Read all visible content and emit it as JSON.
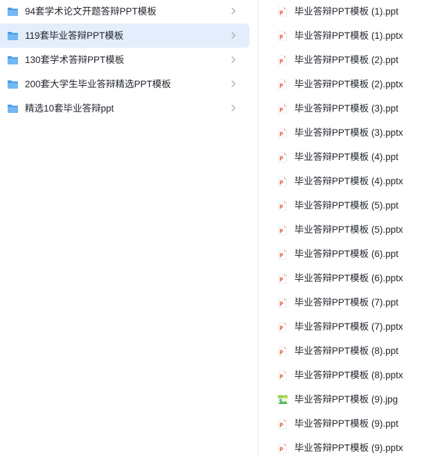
{
  "folders": [
    {
      "label": "94套学术论文开题答辩PPT模板",
      "icon": "folder-icon",
      "selected": false
    },
    {
      "label": "119套毕业答辩PPT模板",
      "icon": "folder-icon",
      "selected": true
    },
    {
      "label": "130套学术答辩PPT模板",
      "icon": "folder-icon",
      "selected": false
    },
    {
      "label": "200套大学生毕业答辩精选PPT模板",
      "icon": "folder-icon",
      "selected": false
    },
    {
      "label": "精选10套毕业答辩ppt",
      "icon": "folder-icon",
      "selected": false
    }
  ],
  "files": [
    {
      "label": "毕业答辩PPT模板 (1).ppt",
      "icon": "ppt-file-icon"
    },
    {
      "label": "毕业答辩PPT模板 (1).pptx",
      "icon": "ppt-file-icon"
    },
    {
      "label": "毕业答辩PPT模板 (2).ppt",
      "icon": "ppt-file-icon"
    },
    {
      "label": "毕业答辩PPT模板 (2).pptx",
      "icon": "ppt-file-icon"
    },
    {
      "label": "毕业答辩PPT模板 (3).ppt",
      "icon": "ppt-file-icon"
    },
    {
      "label": "毕业答辩PPT模板 (3).pptx",
      "icon": "ppt-file-icon"
    },
    {
      "label": "毕业答辩PPT模板 (4).ppt",
      "icon": "ppt-file-icon"
    },
    {
      "label": "毕业答辩PPT模板 (4).pptx",
      "icon": "ppt-file-icon"
    },
    {
      "label": "毕业答辩PPT模板 (5).ppt",
      "icon": "ppt-file-icon"
    },
    {
      "label": "毕业答辩PPT模板 (5).pptx",
      "icon": "ppt-file-icon"
    },
    {
      "label": "毕业答辩PPT模板 (6).ppt",
      "icon": "ppt-file-icon"
    },
    {
      "label": "毕业答辩PPT模板 (6).pptx",
      "icon": "ppt-file-icon"
    },
    {
      "label": "毕业答辩PPT模板 (7).ppt",
      "icon": "ppt-file-icon"
    },
    {
      "label": "毕业答辩PPT模板 (7).pptx",
      "icon": "ppt-file-icon"
    },
    {
      "label": "毕业答辩PPT模板 (8).ppt",
      "icon": "ppt-file-icon"
    },
    {
      "label": "毕业答辩PPT模板 (8).pptx",
      "icon": "ppt-file-icon"
    },
    {
      "label": "毕业答辩PPT模板 (9).jpg",
      "icon": "image-file-icon"
    },
    {
      "label": "毕业答辩PPT模板 (9).ppt",
      "icon": "ppt-file-icon"
    },
    {
      "label": "毕业答辩PPT模板 (9).pptx",
      "icon": "ppt-file-icon"
    }
  ],
  "colors": {
    "selected_background": "#e4edfb",
    "folder_blue": "#5aa9ef",
    "ppt_orange": "#e8623a",
    "divider": "#e6e8eb"
  }
}
